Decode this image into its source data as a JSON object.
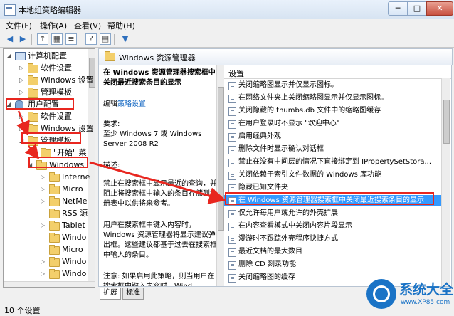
{
  "window": {
    "title": "本地组策略编辑器",
    "min": "─",
    "max": "□",
    "close": "✕"
  },
  "menu": [
    "文件(F)",
    "操作(A)",
    "查看(V)",
    "帮助(H)"
  ],
  "tree": [
    {
      "label": "计算机配置",
      "twisty": "◢",
      "icon": "computer"
    },
    {
      "label": "软件设置",
      "twisty": "▷",
      "icon": "folder"
    },
    {
      "label": "Windows 设置",
      "twisty": "▷",
      "icon": "folder"
    },
    {
      "label": "管理模板",
      "twisty": "▷",
      "icon": "folder"
    },
    {
      "label": "用户配置",
      "twisty": "◢",
      "icon": "user"
    },
    {
      "label": "软件设置",
      "twisty": "▷",
      "icon": "folder"
    },
    {
      "label": "Windows 设置",
      "twisty": "▷",
      "icon": "folder"
    },
    {
      "label": "管理模板",
      "twisty": "◢",
      "icon": "folder"
    },
    {
      "label": "\"开始\" 菜",
      "twisty": "",
      "icon": "folder"
    },
    {
      "label": "Windows",
      "twisty": "◢",
      "icon": "folder"
    },
    {
      "label": "Interne",
      "twisty": "▷",
      "icon": "folder"
    },
    {
      "label": "Micro",
      "twisty": "▷",
      "icon": "folder"
    },
    {
      "label": "NetMe",
      "twisty": "▷",
      "icon": "folder"
    },
    {
      "label": "RSS 源",
      "twisty": "",
      "icon": "folder"
    },
    {
      "label": "Tablet",
      "twisty": "▷",
      "icon": "folder"
    },
    {
      "label": "Windo",
      "twisty": "",
      "icon": "folder"
    },
    {
      "label": "Micro",
      "twisty": "",
      "icon": "folder"
    },
    {
      "label": "Windo",
      "twisty": "▷",
      "icon": "folder"
    },
    {
      "label": "Windo",
      "twisty": "▷",
      "icon": "folder"
    }
  ],
  "header": {
    "title": "Windows 资源管理器"
  },
  "description": {
    "heading": "在 Windows 资源管理器搜索框中关闭最近搜索条目的显示",
    "edit_prefix": "编辑",
    "edit_link": "策略设置",
    "req_label": "要求:",
    "req_text": "至少 Windows 7 或 Windows Server 2008 R2",
    "desc_label": "描述:",
    "desc_text": "禁止在搜索框中显示最近的查询，并阻止将搜索框中输入的条目存储到注册表中以供将来参考。",
    "desc_text2": "用户在搜索框中键入内容时，Windows 资源管理器将显示建议弹出框。这些建议都基于过去在搜索框中输入的条目。",
    "note_text": "注意: 如果启用此策略，则当用户在搜索框中键入内容时，Wind"
  },
  "settings": {
    "column": "设置",
    "items": [
      "关闭缩略图显示并仅显示图标。",
      "在网络文件夹上关闭缩略图显示并仅显示图标。",
      "关闭隐藏的 thumbs.db 文件中的缩略图缓存",
      "在用户登录时不显示 \"欢迎中心\"",
      "启用经典外观",
      "删除文件时显示确认对话框",
      "禁止在没有中间层的情况下直接绑定到 IPropertySetStora...",
      "关闭依赖于索引文件数据的 Windows 库功能",
      "隐藏已知文件夹",
      "在 Windows 资源管理器搜索框中关闭最近搜索条目的显示",
      "仅允许每用户或允许的外壳扩展",
      "在内容查看模式中关闭内容片段显示",
      "漫游时不跟踪外壳程序快捷方式",
      "最近文档的最大数目",
      "删除 CD 刻录功能",
      "关闭缩略图的缓存"
    ],
    "selected_index": 9
  },
  "tabs": [
    "扩展",
    "标准"
  ],
  "status": "10 个设置",
  "watermark": {
    "title": "系统大全",
    "url": "www.XP85.com"
  },
  "colors": {
    "annotation": "#e8261f",
    "selection": "#3399ff",
    "link": "#0b62c0"
  }
}
